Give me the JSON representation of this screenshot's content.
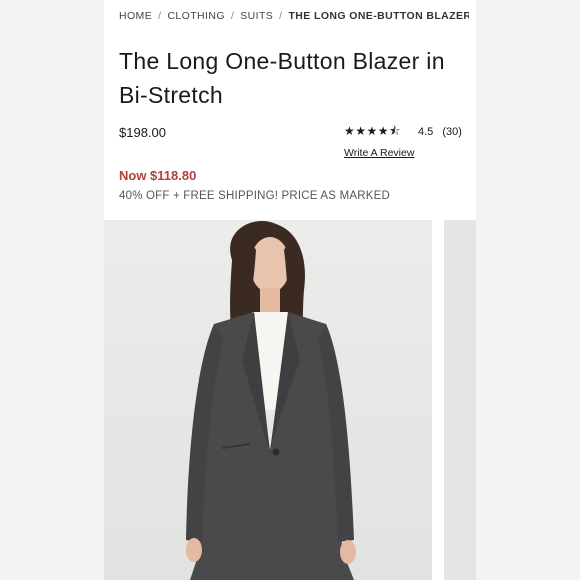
{
  "breadcrumb": {
    "items": [
      "HOME",
      "CLOTHING",
      "SUITS"
    ],
    "current": "THE LONG ONE-BUTTON BLAZER IN ..."
  },
  "product": {
    "title": "The Long One-Button Blazer in Bi-Stretch",
    "price": "$198.00",
    "sale_price": "Now $118.80",
    "promo": "40% OFF + FREE SHIPPING! PRICE AS MARKED"
  },
  "rating": {
    "stars": "★★★★⯪",
    "value": "4.5",
    "count": "(30)",
    "write_review": "Write A Review",
    "score": 4.5
  },
  "colors": {
    "sale_red": "#b3413a",
    "blazer_gray": "#4a4a4c",
    "background": "#f3f3f3"
  }
}
